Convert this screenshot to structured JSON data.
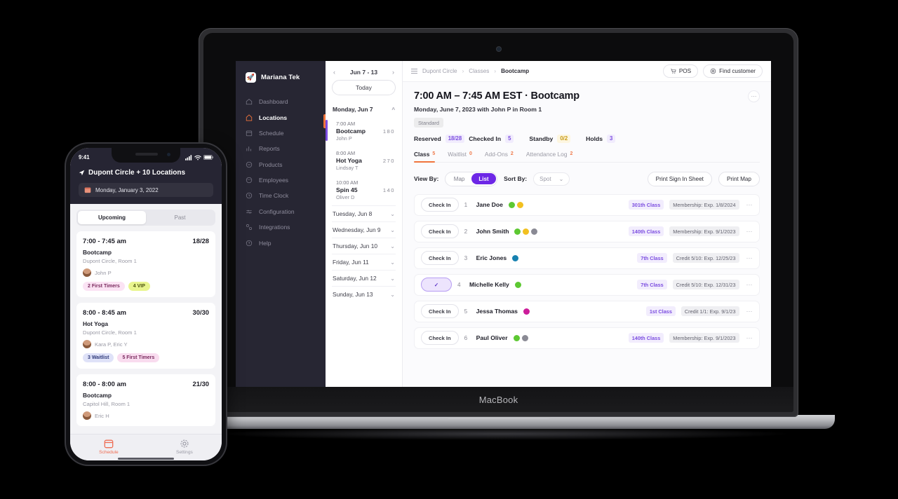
{
  "device": {
    "laptop_label": "MacBook"
  },
  "desktop": {
    "nav": {
      "brand": "Mariana Tek",
      "items": [
        {
          "label": "Dashboard",
          "icon": "home-icon"
        },
        {
          "label": "Locations",
          "icon": "location-icon"
        },
        {
          "label": "Schedule",
          "icon": "calendar-icon"
        },
        {
          "label": "Reports",
          "icon": "bar-chart-icon"
        },
        {
          "label": "Products",
          "icon": "tag-icon"
        },
        {
          "label": "Employees",
          "icon": "people-icon"
        },
        {
          "label": "Time Clock",
          "icon": "clock-icon"
        },
        {
          "label": "Configuration",
          "icon": "sliders-icon"
        },
        {
          "label": "Integrations",
          "icon": "puzzle-icon"
        },
        {
          "label": "Help",
          "icon": "help-icon"
        }
      ],
      "active": "Locations"
    },
    "topbar": {
      "breadcrumb": [
        "Dupont Circle",
        "Classes",
        "Bootcamp"
      ],
      "pos_label": "POS",
      "find_customer_label": "Find customer"
    },
    "schedule": {
      "week_range": "Jun 7 - 13",
      "today_label": "Today",
      "expanded_day": "Monday, Jun 7",
      "classes": [
        {
          "time": "7:00 AM",
          "name": "Bootcamp",
          "reserved": "18",
          "waitlist": "0",
          "staff": "John P",
          "accent": "#7b4ce0"
        },
        {
          "time": "8:00 AM",
          "name": "Hot Yoga",
          "reserved": "27",
          "waitlist": "0",
          "staff": "Lindsay T",
          "accent": "#ffffff"
        },
        {
          "time": "10:00 AM",
          "name": "Spin 45",
          "reserved": "14",
          "waitlist": "0",
          "staff": "Oliver D",
          "accent": "#ffffff"
        }
      ],
      "other_days": [
        "Tuesday, Jun 8",
        "Wednesday, Jun 9",
        "Thursday, Jun 10",
        "Friday, Jun 11",
        "Saturday, Jun 12",
        "Sunday, Jun 13"
      ]
    },
    "class_detail": {
      "title": "7:00 AM – 7:45 AM EST · Bootcamp",
      "subtitle": "Monday, June 7, 2023 with John P in Room 1",
      "type_tag": "Standard",
      "stats": [
        {
          "key": "Reserved",
          "value": "18/28",
          "style": "purple"
        },
        {
          "key": "Checked In",
          "value": "5",
          "style": "purple"
        },
        {
          "key": "Standby",
          "value": "0/2",
          "style": "yellow"
        },
        {
          "key": "Holds",
          "value": "3",
          "style": "purple"
        }
      ],
      "tabs": [
        {
          "label": "Class",
          "badge": "5",
          "active": true
        },
        {
          "label": "Waitlist",
          "badge": "0",
          "active": false
        },
        {
          "label": "Add-Ons",
          "badge": "2",
          "active": false
        },
        {
          "label": "Attendance Log",
          "badge": "2",
          "active": false
        }
      ],
      "controls": {
        "view_by_label": "View By:",
        "view_options": [
          "Map",
          "List"
        ],
        "view_selected": "List",
        "sort_by_label": "Sort By:",
        "sort_value": "Spot",
        "print_sign_in_label": "Print Sign In Sheet",
        "print_map_label": "Print Map"
      },
      "check_in_label": "Check In",
      "checked_glyph": "✓",
      "attendees": [
        {
          "num": "1",
          "name": "Jane Doe",
          "checked": false,
          "dots": [
            {
              "color": "#5dc832",
              "name": "green-status-dot"
            },
            {
              "color": "#f2c020",
              "name": "yellow-status-dot"
            }
          ],
          "class_pill": "301th Class",
          "plan_pill": "Membership: Exp. 1/8/2024"
        },
        {
          "num": "2",
          "name": "John Smith",
          "checked": false,
          "dots": [
            {
              "color": "#5dc832",
              "name": "green-status-dot"
            },
            {
              "color": "#f2c020",
              "name": "yellow-status-dot"
            },
            {
              "color": "#8a8a94",
              "name": "gray-status-dot"
            }
          ],
          "class_pill": "140th Class",
          "plan_pill": "Membership: Exp. 9/1/2023"
        },
        {
          "num": "3",
          "name": "Eric Jones",
          "checked": false,
          "dots": [
            {
              "color": "#1681b0",
              "name": "blue-status-dot"
            }
          ],
          "class_pill": "7th Class",
          "plan_pill": "Credit 5/10: Exp. 12/25/23"
        },
        {
          "num": "4",
          "name": "Michelle Kelly",
          "checked": true,
          "dots": [
            {
              "color": "#5dc832",
              "name": "green-status-dot"
            }
          ],
          "class_pill": "7th Class",
          "plan_pill": "Credit 5/10: Exp. 12/31/23"
        },
        {
          "num": "5",
          "name": "Jessa Thomas",
          "checked": false,
          "dots": [
            {
              "color": "#cc1d9a",
              "name": "magenta-status-dot"
            }
          ],
          "class_pill": "1st Class",
          "plan_pill": "Credit 1/1: Exp. 9/1/23"
        },
        {
          "num": "6",
          "name": "Paul Oliver",
          "checked": false,
          "dots": [
            {
              "color": "#5dc832",
              "name": "green-status-dot"
            },
            {
              "color": "#8a8a94",
              "name": "gray-status-dot"
            }
          ],
          "class_pill": "140th Class",
          "plan_pill": "Membership: Exp. 9/1/2023"
        }
      ]
    }
  },
  "phone": {
    "status": {
      "time": "9:41"
    },
    "location_header": "Dupont Circle + 10 Locations",
    "date": "Monday, January 3, 2022",
    "tabs": {
      "options": [
        "Upcoming",
        "Past"
      ],
      "selected": "Upcoming"
    },
    "cards": [
      {
        "time": "7:00 - 7:45 am",
        "capacity": "18/28",
        "name": "Bootcamp",
        "room": "Dupont Circle, Room 1",
        "staff": "John P",
        "tags": [
          {
            "label": "2 First Timers",
            "style": "pink"
          },
          {
            "label": "4 VIP",
            "style": "lime"
          }
        ]
      },
      {
        "time": "8:00 - 8:45 am",
        "capacity": "30/30",
        "name": "Hot Yoga",
        "room": "Dupont Circle, Room 1",
        "staff": "Kara P, Eric Y",
        "tags": [
          {
            "label": "3 Waitlist",
            "style": "blue"
          },
          {
            "label": "5 First Timers",
            "style": "pink2"
          }
        ]
      },
      {
        "time": "8:00 - 8:00 am",
        "capacity": "21/30",
        "name": "Bootcamp",
        "room": "Capitol Hill, Room 1",
        "staff": "Eric H",
        "tags": []
      }
    ],
    "tabbar": [
      {
        "label": "Schedule",
        "icon": "calendar-icon",
        "active": true
      },
      {
        "label": "Settings",
        "icon": "gear-icon",
        "active": false
      }
    ]
  },
  "colors": {
    "brand_orange": "#f0743c",
    "accent_purple": "#6d27e6",
    "nav_dark": "#272633"
  }
}
